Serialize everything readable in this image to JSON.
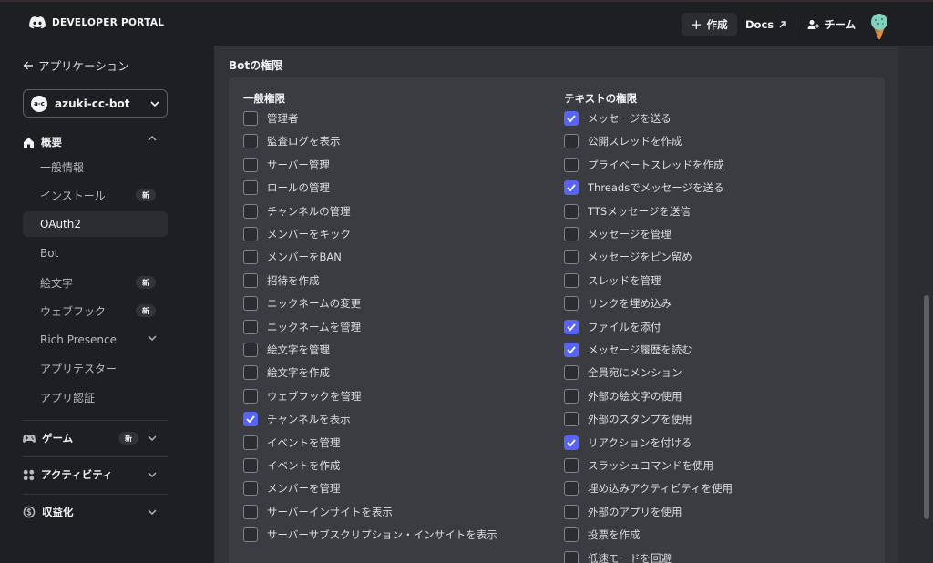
{
  "brand": {
    "name": "DEVELOPER PORTAL"
  },
  "topbar": {
    "create": "作成",
    "docs": "Docs",
    "team": "チーム"
  },
  "sidebar": {
    "back": "アプリケーション",
    "app_icon_text": "a-c",
    "app_name": "azuki-cc-bot",
    "overview": "概要",
    "items": [
      {
        "label": "一般情報"
      },
      {
        "label": "インストール",
        "badge": "新"
      },
      {
        "label": "OAuth2",
        "active": true
      },
      {
        "label": "Bot"
      },
      {
        "label": "絵文字",
        "badge": "新"
      },
      {
        "label": "ウェブフック",
        "badge": "新"
      },
      {
        "label": "Rich Presence",
        "expandable": true
      },
      {
        "label": "アプリテスター"
      },
      {
        "label": "アプリ認証"
      }
    ],
    "games": {
      "label": "ゲーム",
      "badge": "新"
    },
    "activities": {
      "label": "アクティビティ"
    },
    "monetization": {
      "label": "収益化"
    }
  },
  "main": {
    "section_title": "Botの権限",
    "general": {
      "heading": "一般権限",
      "perms": [
        {
          "label": "管理者",
          "checked": false
        },
        {
          "label": "監査ログを表示",
          "checked": false
        },
        {
          "label": "サーバー管理",
          "checked": false
        },
        {
          "label": "ロールの管理",
          "checked": false
        },
        {
          "label": "チャンネルの管理",
          "checked": false
        },
        {
          "label": "メンバーをキック",
          "checked": false
        },
        {
          "label": "メンバーをBAN",
          "checked": false
        },
        {
          "label": "招待を作成",
          "checked": false
        },
        {
          "label": "ニックネームの変更",
          "checked": false
        },
        {
          "label": "ニックネームを管理",
          "checked": false
        },
        {
          "label": "絵文字を管理",
          "checked": false
        },
        {
          "label": "絵文字を作成",
          "checked": false
        },
        {
          "label": "ウェブフックを管理",
          "checked": false
        },
        {
          "label": "チャンネルを表示",
          "checked": true
        },
        {
          "label": "イベントを管理",
          "checked": false
        },
        {
          "label": "イベントを作成",
          "checked": false
        },
        {
          "label": "メンバーを管理",
          "checked": false
        },
        {
          "label": "サーバーインサイトを表示",
          "checked": false
        },
        {
          "label": "サーバーサブスクリプション・インサイトを表示",
          "checked": false
        }
      ]
    },
    "text": {
      "heading": "テキストの権限",
      "perms": [
        {
          "label": "メッセージを送る",
          "checked": true
        },
        {
          "label": "公開スレッドを作成",
          "checked": false
        },
        {
          "label": "プライベートスレッドを作成",
          "checked": false
        },
        {
          "label": "Threadsでメッセージを送る",
          "checked": true
        },
        {
          "label": "TTSメッセージを送信",
          "checked": false
        },
        {
          "label": "メッセージを管理",
          "checked": false
        },
        {
          "label": "メッセージをピン留め",
          "checked": false
        },
        {
          "label": "スレッドを管理",
          "checked": false
        },
        {
          "label": "リンクを埋め込み",
          "checked": false
        },
        {
          "label": "ファイルを添付",
          "checked": true
        },
        {
          "label": "メッセージ履歴を読む",
          "checked": true
        },
        {
          "label": "全員宛にメンション",
          "checked": false
        },
        {
          "label": "外部の絵文字の使用",
          "checked": false
        },
        {
          "label": "外部のスタンプを使用",
          "checked": false
        },
        {
          "label": "リアクションを付ける",
          "checked": true
        },
        {
          "label": "スラッシュコマンドを使用",
          "checked": false
        },
        {
          "label": "埋め込みアクティビティを使用",
          "checked": false
        },
        {
          "label": "外部のアプリを使用",
          "checked": false
        },
        {
          "label": "投票を作成",
          "checked": false
        },
        {
          "label": "低速モードを回避",
          "checked": false
        }
      ]
    }
  },
  "colors": {
    "accent": "#5865f2",
    "bg": "#1e1f22",
    "panel": "#313338",
    "card": "#3a3c42"
  }
}
